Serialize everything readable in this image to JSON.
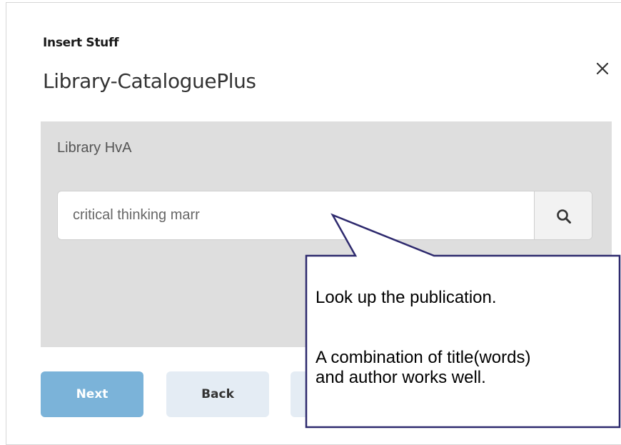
{
  "dialog": {
    "eyebrow": "Insert Stuff",
    "title": "Library-CataloguePlus",
    "close_icon": "close-icon"
  },
  "panel": {
    "label": "Library HvA",
    "search": {
      "value": "critical thinking marr",
      "button_icon": "search-icon"
    }
  },
  "buttons": {
    "next": "Next",
    "back": "Back"
  },
  "callout": {
    "line1": "Look up the publication.",
    "line2": "A combination of title(words)",
    "line3": "and author works well."
  },
  "colors": {
    "primary_button": "#7bb3d9",
    "secondary_button": "#e4ecf4",
    "panel_bg": "#dedede",
    "callout_border": "#2e2a6e"
  }
}
